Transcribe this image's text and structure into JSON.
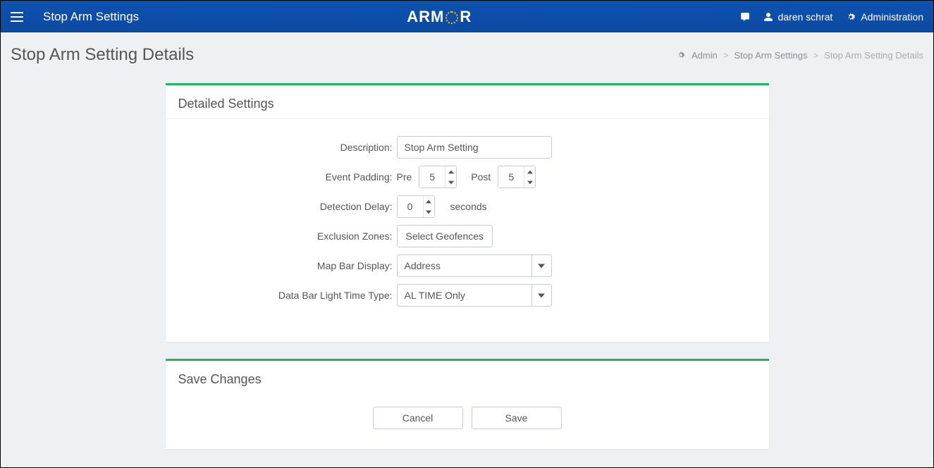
{
  "navbar": {
    "page_label": "Stop Arm Settings",
    "brand_prefix": "ARM",
    "brand_suffix": "R",
    "user_name": "daren schrat",
    "admin_label": "Administration"
  },
  "header": {
    "title": "Stop Arm Setting Details"
  },
  "breadcrumb": {
    "root": "Admin",
    "level1": "Stop Arm Settings",
    "current": "Stop Arm Setting Details"
  },
  "panel1": {
    "title": "Detailed Settings",
    "labels": {
      "description": "Description:",
      "event_padding": "Event Padding:",
      "pre": "Pre",
      "post": "Post",
      "detection_delay": "Detection Delay:",
      "seconds": "seconds",
      "exclusion_zones": "Exclusion Zones:",
      "map_bar_display": "Map Bar Display:",
      "data_bar_light": "Data Bar Light Time Type:"
    },
    "values": {
      "description": "Stop Arm Setting",
      "pre": "5",
      "post": "5",
      "detection_delay": "0",
      "geofence_btn": "Select Geofences",
      "map_bar_display": "Address",
      "data_bar_light": "AL TIME Only"
    }
  },
  "panel2": {
    "title": "Save Changes",
    "cancel": "Cancel",
    "save": "Save"
  }
}
